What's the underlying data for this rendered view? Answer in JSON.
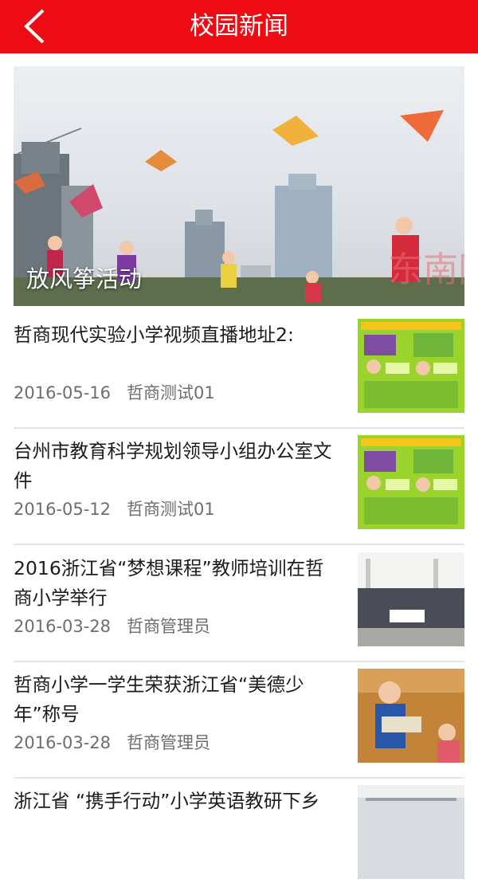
{
  "header": {
    "title": "校园新闻",
    "back_icon": "chevron-left-icon"
  },
  "banner": {
    "caption": "放风筝活动",
    "watermark": "东南网"
  },
  "news": [
    {
      "title": "哲商现代实验小学视频直播地址2:",
      "date": "2016-05-16",
      "author": "哲商测试01"
    },
    {
      "title": "台州市教育科学规划领导小组办公室文件",
      "date": "2016-05-12",
      "author": "哲商测试01"
    },
    {
      "title": " 2016浙江省“梦想课程”教师培训在哲商小学举行",
      "date": "2016-03-28",
      "author": "哲商管理员"
    },
    {
      "title": "哲商小学一学生荣获浙江省“美德少年”称号",
      "date": "2016-03-28",
      "author": "哲商管理员"
    },
    {
      "title": "浙江省 “携手行动”小学英语教研下乡",
      "date": "",
      "author": ""
    }
  ],
  "colors": {
    "header_bg": "#ee0c14",
    "title_text": "#1c1c1c",
    "meta_text": "#6d6d6d",
    "divider": "#e3e3e3"
  }
}
